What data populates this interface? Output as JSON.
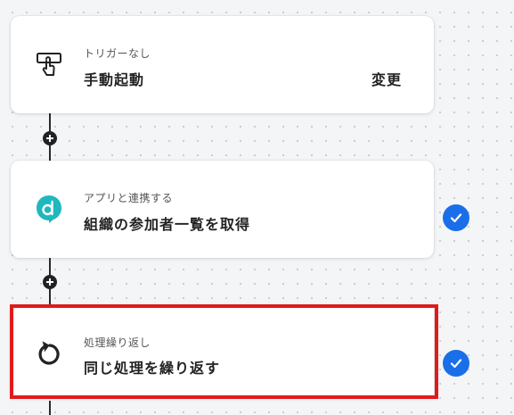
{
  "steps": [
    {
      "subtitle": "トリガーなし",
      "title": "手動起動",
      "action_label": "変更",
      "icon": "hand-pointer-icon"
    },
    {
      "subtitle": "アプリと連携する",
      "title": "組織の参加者一覧を取得",
      "icon": "app-d-logo-icon",
      "status": "completed"
    },
    {
      "subtitle": "処理繰り返し",
      "title": "同じ処理を繰り返す",
      "icon": "loop-arrow-icon",
      "status": "completed",
      "highlighted": true
    }
  ],
  "colors": {
    "check": "#1a6fe8",
    "highlight": "#e01b1b",
    "app_logo": "#1fb8bd"
  }
}
